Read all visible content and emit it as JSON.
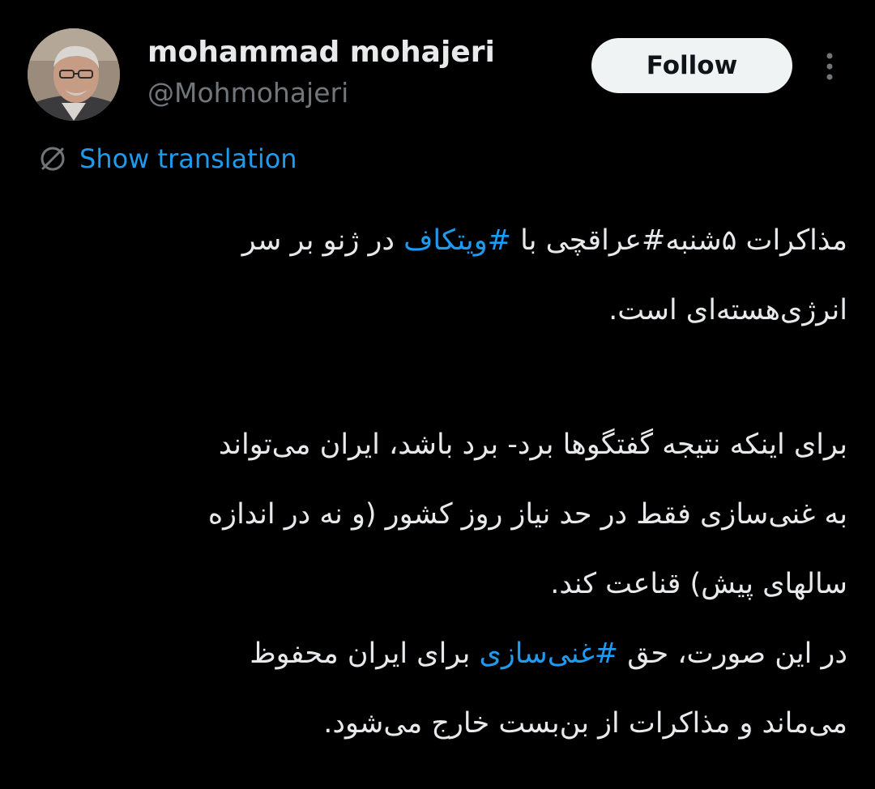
{
  "author": {
    "display_name": "mohammad mohajeri",
    "handle": "@Mohmohajeri",
    "avatar_alt": "profile photo"
  },
  "actions": {
    "follow_label": "Follow",
    "more_icon": "more-vertical-icon"
  },
  "translation": {
    "label": "Show translation",
    "icon": "globe-icon"
  },
  "tweet": {
    "line1_before": "مذاکرات ۵شنبه",
    "line1_tag_plain": "#عراقچی",
    "line1_mid": " با ",
    "line1_tag_link": "#ویتکاف",
    "line1_after": " در ژنو بر سر",
    "line2": "انرژی‌هسته‌ای است.",
    "line3": "برای اینکه نتیجه گفتگوها برد- برد باشد، ایران می‌تواند",
    "line4": "به غنی‌سازی فقط در حد نیاز روز کشور (و نه در اندازه",
    "line5": "سالهای پیش) قناعت کند.",
    "line6_before": "در این صورت، حق ",
    "line6_tag_link": "#غنی‌سازی",
    "line6_after": " برای ایران محفوظ",
    "line7": "می‌ماند و مذاکرات از بن‌بست خارج می‌شود."
  },
  "colors": {
    "background": "#000000",
    "text": "#e7e9ea",
    "secondary": "#71767b",
    "link": "#1d9bf0",
    "follow_bg": "#eff3f4"
  }
}
